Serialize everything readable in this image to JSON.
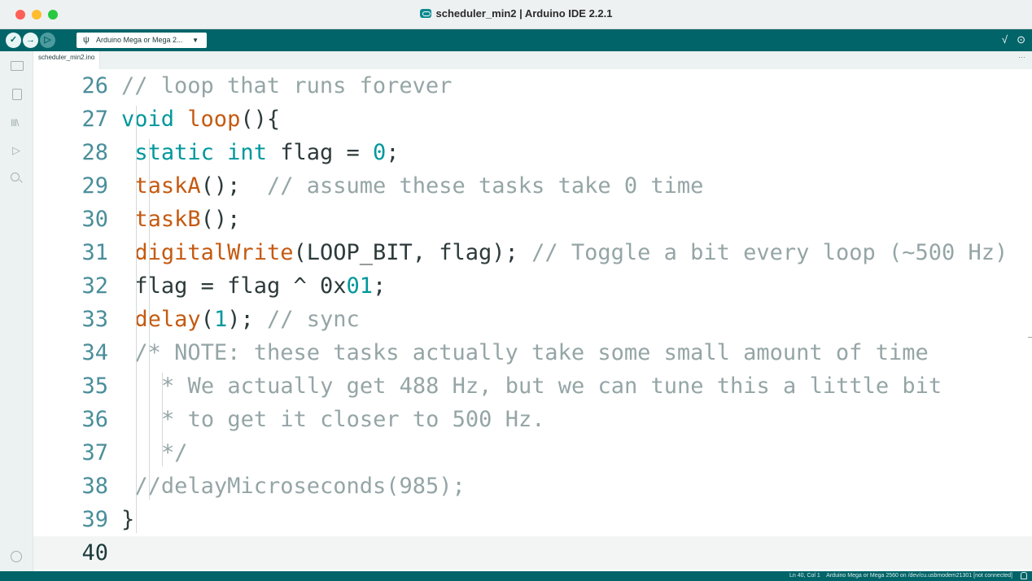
{
  "window": {
    "title": "scheduler_min2 | Arduino IDE 2.2.1"
  },
  "toolbar": {
    "verify_icon": "✓",
    "upload_icon": "→",
    "debug_icon": "▷",
    "board_label": "Arduino Mega or Mega 2...",
    "usb_icon": "ψ",
    "chevron_icon": "▼",
    "serial_plotter_icon": "√",
    "serial_monitor_icon": "⊙"
  },
  "tabs": [
    {
      "label": "scheduler_min2.ino"
    }
  ],
  "tab_more": "···",
  "editor": {
    "lines": [
      {
        "num": "26",
        "tokens": [
          {
            "t": "cm",
            "v": "// loop that runs forever"
          }
        ]
      },
      {
        "num": "27",
        "tokens": [
          {
            "t": "kw",
            "v": "void"
          },
          {
            "t": "pl",
            "v": " "
          },
          {
            "t": "fn",
            "v": "loop"
          },
          {
            "t": "pl",
            "v": "(){"
          }
        ]
      },
      {
        "num": "28",
        "tokens": [
          {
            "t": "kw",
            "v": "static int"
          },
          {
            "t": "pl",
            "v": " flag = "
          },
          {
            "t": "hx",
            "v": "0"
          },
          {
            "t": "pl",
            "v": ";"
          }
        ]
      },
      {
        "num": "29",
        "tokens": [
          {
            "t": "fn",
            "v": "taskA"
          },
          {
            "t": "pl",
            "v": "();  "
          },
          {
            "t": "cm",
            "v": "// assume these tasks take 0 time"
          }
        ]
      },
      {
        "num": "30",
        "tokens": [
          {
            "t": "fn",
            "v": "taskB"
          },
          {
            "t": "pl",
            "v": "();"
          }
        ]
      },
      {
        "num": "31",
        "tokens": [
          {
            "t": "fn",
            "v": "digitalWrite"
          },
          {
            "t": "pl",
            "v": "(LOOP_BIT, flag); "
          },
          {
            "t": "cm",
            "v": "// Toggle a bit every loop (~500 Hz)"
          }
        ]
      },
      {
        "num": "32",
        "tokens": [
          {
            "t": "pl",
            "v": "flag = flag ^ "
          },
          {
            "t": "pl",
            "v": "0x"
          },
          {
            "t": "hx",
            "v": "01"
          },
          {
            "t": "pl",
            "v": ";"
          }
        ]
      },
      {
        "num": "33",
        "tokens": [
          {
            "t": "fn",
            "v": "delay"
          },
          {
            "t": "pl",
            "v": "("
          },
          {
            "t": "hx",
            "v": "1"
          },
          {
            "t": "pl",
            "v": "); "
          },
          {
            "t": "cm",
            "v": "// sync"
          }
        ]
      },
      {
        "num": "34",
        "tokens": [
          {
            "t": "cm",
            "v": "/* NOTE: these tasks actually take some small amount of time"
          }
        ]
      },
      {
        "num": "35",
        "tokens": [
          {
            "t": "cm",
            "v": " * We actually get 488 Hz, but we can tune this a little bit"
          }
        ]
      },
      {
        "num": "36",
        "tokens": [
          {
            "t": "cm",
            "v": " * to get it closer to 500 Hz."
          }
        ]
      },
      {
        "num": "37",
        "tokens": [
          {
            "t": "cm",
            "v": " */"
          }
        ]
      },
      {
        "num": "38",
        "tokens": [
          {
            "t": "cm",
            "v": "//delayMicroseconds(985);"
          }
        ]
      },
      {
        "num": "39",
        "tokens": [
          {
            "t": "pl",
            "v": "}"
          }
        ]
      },
      {
        "num": "40",
        "tokens": []
      }
    ]
  },
  "status": {
    "text": "Ln 40, Col 1    Arduino Mega or Mega 2560 on /dev/cu.usbmodem21301 [not connected]"
  }
}
